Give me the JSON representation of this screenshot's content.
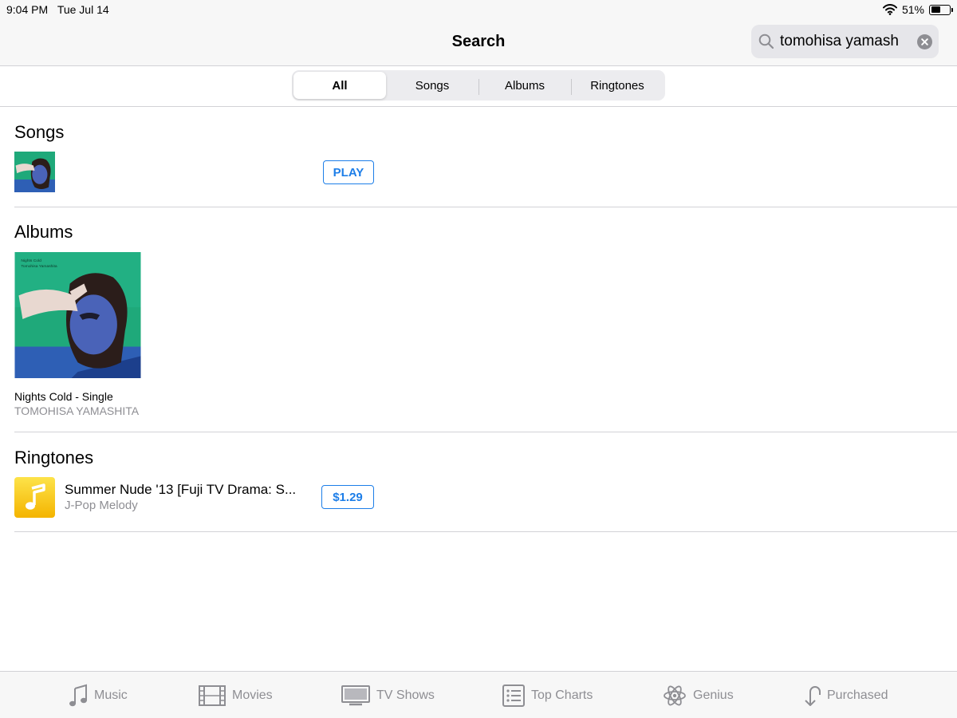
{
  "status": {
    "time": "9:04 PM",
    "date": "Tue Jul 14",
    "battery": "51%",
    "battery_level": 0.51
  },
  "nav": {
    "title": "Search",
    "search_value": "tomohisa yamash"
  },
  "segments": [
    {
      "label": "All",
      "active": true
    },
    {
      "label": "Songs",
      "active": false
    },
    {
      "label": "Albums",
      "active": false
    },
    {
      "label": "Ringtones",
      "active": false
    }
  ],
  "songs": {
    "title": "Songs",
    "play_label": "PLAY"
  },
  "albums": {
    "title": "Albums",
    "items": [
      {
        "name": "Nights Cold - Single",
        "artist": "TOMOHISA YAMASHITA",
        "cover_text_1": "Nights Cold",
        "cover_text_2": "Tomohisa Yamashita"
      }
    ]
  },
  "ringtones": {
    "title": "Ringtones",
    "items": [
      {
        "name": "Summer Nude '13 [Fuji TV Drama: S...",
        "subtitle": "J-Pop Melody",
        "price": "$1.29"
      }
    ]
  },
  "tabs": [
    {
      "label": "Music",
      "icon": "music-note-icon"
    },
    {
      "label": "Movies",
      "icon": "film-strip-icon"
    },
    {
      "label": "TV Shows",
      "icon": "tv-icon"
    },
    {
      "label": "Top Charts",
      "icon": "list-icon"
    },
    {
      "label": "Genius",
      "icon": "atom-icon"
    },
    {
      "label": "Purchased",
      "icon": "purchased-icon"
    }
  ],
  "colors": {
    "accent": "#1d7ee8",
    "secondary_text": "#8e8e93",
    "bar_bg": "#f7f7f7",
    "cover_green": "#1fa97a",
    "ringtone_yellow": "#f7c808"
  }
}
